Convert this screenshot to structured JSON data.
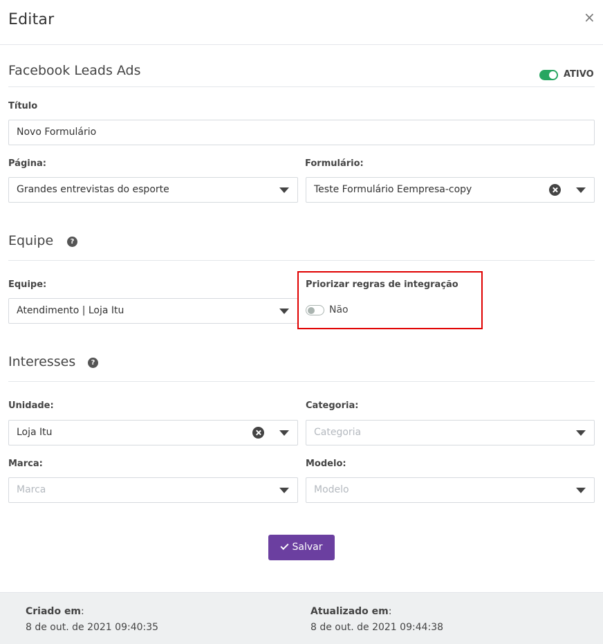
{
  "modal": {
    "title": "Editar",
    "close_glyph": "×"
  },
  "integration": {
    "name": "Facebook Leads Ads",
    "status_label": "ATIVO",
    "status_on": true
  },
  "titulo": {
    "label": "Título",
    "value": "Novo Formulário"
  },
  "pagina": {
    "label": "Página:",
    "value": "Grandes entrevistas do esporte"
  },
  "formulario": {
    "label": "Formulário:",
    "value": "Teste Formulário Eempresa-copy"
  },
  "equipe_section": {
    "title": "Equipe",
    "help_glyph": "?"
  },
  "equipe": {
    "label": "Equipe:",
    "value": "Atendimento | Loja Itu"
  },
  "priorizar": {
    "label": "Priorizar regras de integração",
    "value_label": "Não",
    "on": false
  },
  "interesses_section": {
    "title": "Interesses",
    "help_glyph": "?"
  },
  "unidade": {
    "label": "Unidade:",
    "value": "Loja Itu"
  },
  "categoria": {
    "label": "Categoria:",
    "placeholder": "Categoria"
  },
  "marca": {
    "label": "Marca:",
    "placeholder": "Marca"
  },
  "modelo": {
    "label": "Modelo:",
    "placeholder": "Modelo"
  },
  "actions": {
    "save_label": "Salvar"
  },
  "footer": {
    "created_label": "Criado em",
    "created_value": "8 de out. de 2021 09:40:35",
    "updated_label": "Atualizado em",
    "updated_value": "8 de out. de 2021 09:44:38",
    "separator": ":"
  },
  "colors": {
    "accent": "#6b3fa0",
    "active_toggle": "#27a661",
    "highlight": "#e00000"
  },
  "icons": [
    "close-icon",
    "toggle-switch",
    "help-icon",
    "clear-icon",
    "chevron-down-icon",
    "check-icon"
  ]
}
